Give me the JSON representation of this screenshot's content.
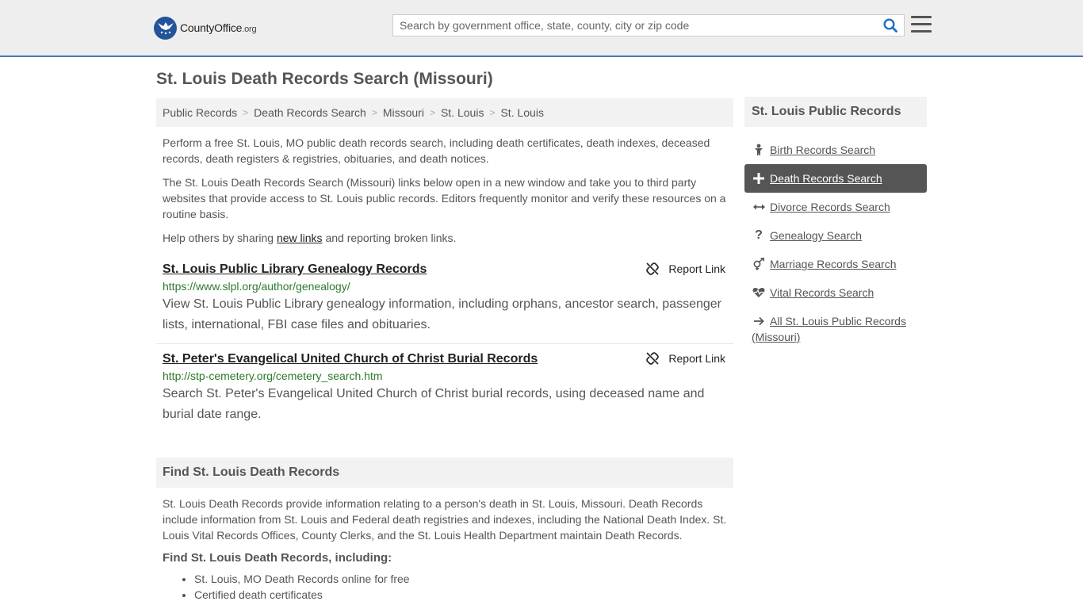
{
  "header": {
    "logo_main": "CountyOffice",
    "logo_tld": ".org",
    "search_placeholder": "Search by government office, state, county, city or zip code"
  },
  "page": {
    "title": "St. Louis Death Records Search (Missouri)"
  },
  "breadcrumb": [
    "Public Records",
    "Death Records Search",
    "Missouri",
    "St. Louis",
    "St. Louis"
  ],
  "intro": {
    "p1": "Perform a free St. Louis, MO public death records search, including death certificates, death indexes, deceased records, death registers & registries, obituaries, and death notices.",
    "p2": "The St. Louis Death Records Search (Missouri) links below open in a new window and take you to third party websites that provide access to St. Louis public records. Editors frequently monitor and verify these resources on a routine basis.",
    "p3_before": "Help others by sharing ",
    "p3_link": "new links",
    "p3_after": " and reporting broken links."
  },
  "results": [
    {
      "title": "St. Louis Public Library Genealogy Records",
      "url": "https://www.slpl.org/author/genealogy/",
      "description": "View St. Louis Public Library genealogy information, including orphans, ancestor search, passenger lists, international, FBI case files and obituaries.",
      "report_label": "Report Link"
    },
    {
      "title": "St. Peter's Evangelical United Church of Christ Burial Records",
      "url": "http://stp-cemetery.org/cemetery_search.htm",
      "description": "Search St. Peter's Evangelical United Church of Christ burial records, using deceased name and burial date range.",
      "report_label": "Report Link"
    }
  ],
  "find_section": {
    "heading": "Find St. Louis Death Records",
    "body": "St. Louis Death Records provide information relating to a person's death in St. Louis, Missouri. Death Records include information from St. Louis and Federal death registries and indexes, including the National Death Index. St. Louis Vital Records Offices, County Clerks, and the St. Louis Health Department maintain Death Records.",
    "subheading": "Find St. Louis Death Records, including:",
    "bullets": [
      "St. Louis, MO Death Records online for free",
      "Certified death certificates"
    ]
  },
  "sidebar": {
    "heading": "St. Louis Public Records",
    "items": [
      {
        "label": "Birth Records Search",
        "icon": "baby-icon"
      },
      {
        "label": "Death Records Search",
        "icon": "cross-icon"
      },
      {
        "label": "Divorce Records Search",
        "icon": "arrows-horizontal-icon"
      },
      {
        "label": "Genealogy Search",
        "icon": "question-icon"
      },
      {
        "label": "Marriage Records Search",
        "icon": "gender-icon"
      },
      {
        "label": "Vital Records Search",
        "icon": "heartbeat-icon"
      },
      {
        "label": "All St. Louis Public Records (Missouri)",
        "icon": "arrow-right-icon"
      }
    ]
  },
  "colors": {
    "header_bg": "#eeeeee",
    "header_border": "#4a7ab5",
    "logo_blue": "#23539a",
    "search_icon": "#1e6fc4",
    "url_green": "#2c7a2c",
    "active_bg": "#555555"
  }
}
